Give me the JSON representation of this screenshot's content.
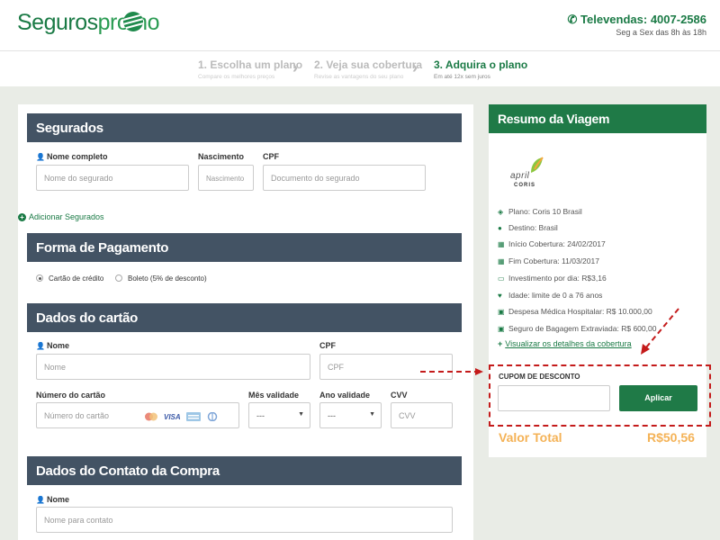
{
  "brand": {
    "name_a": "Seguros",
    "name_b": "promo"
  },
  "contact": {
    "phone": "Televendas: 4007-2586",
    "hours": "Seg a Sex das 8h às 18h"
  },
  "steps": [
    {
      "title": "1. Escolha um plano",
      "subtitle": "Compare os melhores preços"
    },
    {
      "title": "2. Veja sua cobertura",
      "subtitle": "Revise as vantagens do seu plano"
    },
    {
      "title": "3. Adquira o plano",
      "subtitle": "Em até 12x sem juros"
    }
  ],
  "segurados": {
    "title": "Segurados",
    "name_label": "Nome completo",
    "name_placeholder": "Nome do segurado",
    "birth_label": "Nascimento",
    "birth_placeholder": "Nascimento",
    "cpf_label": "CPF",
    "cpf_placeholder": "Documento do segurado",
    "add_link": "Adicionar Segurados"
  },
  "pagamento": {
    "title": "Forma de Pagamento",
    "option_card": "Cartão de crédito",
    "option_boleto": "Boleto (5% de desconto)"
  },
  "cartao": {
    "title": "Dados do cartão",
    "name_label": "Nome",
    "name_placeholder": "Nome",
    "cpf_label": "CPF",
    "cpf_placeholder": "CPF",
    "number_label": "Número do cartão",
    "number_placeholder": "Número do cartão",
    "month_label": "Mês validade",
    "month_value": "---",
    "year_label": "Ano validade",
    "year_value": "---",
    "cvv_label": "CVV",
    "cvv_placeholder": "CVV",
    "brands": [
      "VISA"
    ]
  },
  "contato": {
    "title": "Dados do Contato da Compra",
    "name_label": "Nome",
    "name_placeholder": "Nome para contato"
  },
  "resumo": {
    "title": "Resumo da Viagem",
    "insurer_a": "april",
    "insurer_b": "CORIS",
    "items": [
      {
        "icon": "tag-icon",
        "text": "Plano: Coris 10 Brasil"
      },
      {
        "icon": "map-pin-icon",
        "text": "Destino: Brasil"
      },
      {
        "icon": "calendar-icon",
        "text": "Início Cobertura: 24/02/2017"
      },
      {
        "icon": "calendar-icon",
        "text": "Fim Cobertura: 11/03/2017"
      },
      {
        "icon": "money-icon",
        "text": "Investimento por dia: R$3,16"
      },
      {
        "icon": "heart-icon",
        "text": "Idade: limite de 0 a 76 anos"
      },
      {
        "icon": "medkit-icon",
        "text": "Despesa Médica Hospitalar: R$ 10.000,00"
      },
      {
        "icon": "suitcase-icon",
        "text": "Seguro de Bagagem Extraviada: R$ 600,00"
      }
    ],
    "details_link": "Visualizar os detalhes da cobertura"
  },
  "coupon": {
    "label": "CUPOM DE DESCONTO",
    "button": "Aplicar"
  },
  "total": {
    "label": "Valor Total",
    "value": "R$50,56"
  },
  "colors": {
    "green": "#1f7a47",
    "section_header": "#435364",
    "total": "#f4b256",
    "annotation": "#c41b1b"
  }
}
